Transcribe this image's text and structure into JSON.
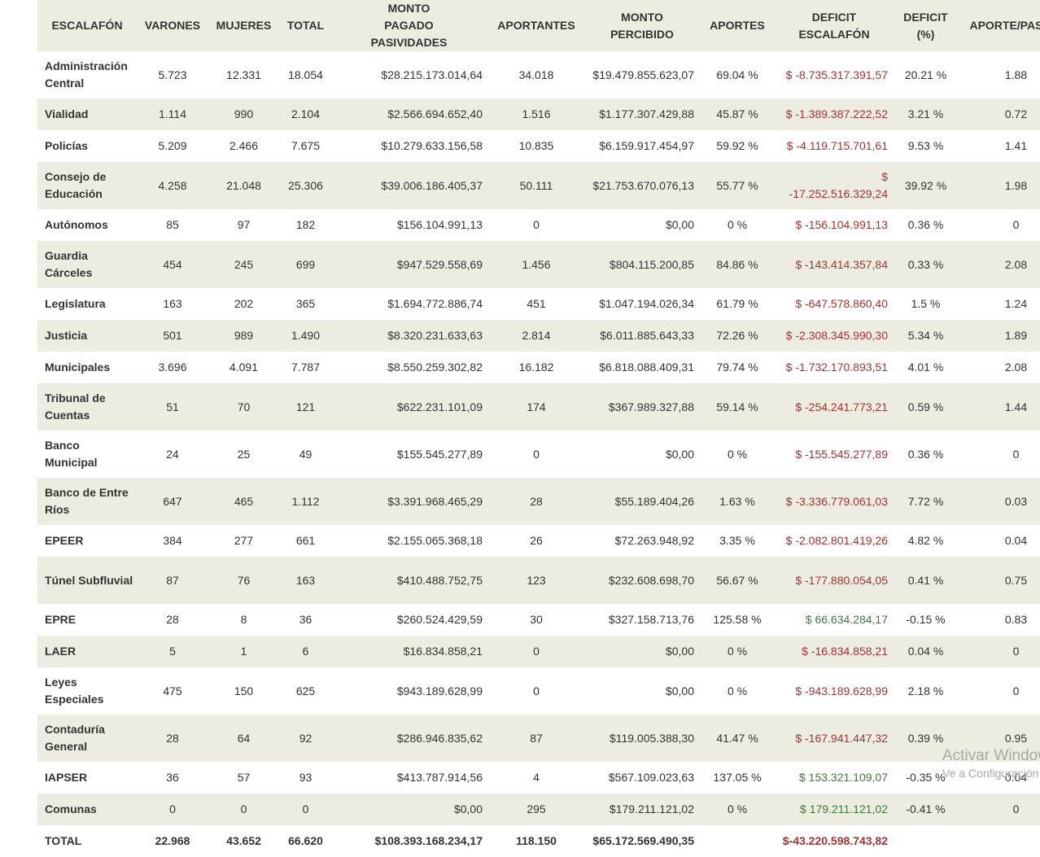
{
  "headers": [
    "ESCALAFÓN",
    "VARONES",
    "MUJERES",
    "TOTAL",
    "MONTO PAGADO PASIVIDADES",
    "APORTANTES",
    "MONTO PERCIBIDO",
    "APORTES",
    "DEFICIT ESCALAFÓN",
    "DEFICIT (%)",
    "APORTE/PASIVO"
  ],
  "rows": [
    {
      "name": "Administración Central",
      "varones": "5.723",
      "mujeres": "12.331",
      "total": "18.054",
      "monto_pagado": "$28.215.173.014,64",
      "aportantes": "34.018",
      "monto_percibido": "$19.479.855.623,07",
      "aportes": "69.04 %",
      "deficit": "$ -8.735.317.391,57",
      "deficit_sign": "neg",
      "deficit_pct": "20.21 %",
      "aporte_pasivo": "1.88"
    },
    {
      "name": "Vialidad",
      "varones": "1.114",
      "mujeres": "990",
      "total": "2.104",
      "monto_pagado": "$2.566.694.652,40",
      "aportantes": "1.516",
      "monto_percibido": "$1.177.307.429,88",
      "aportes": "45.87 %",
      "deficit": "$ -1.389.387.222,52",
      "deficit_sign": "neg",
      "deficit_pct": "3.21 %",
      "aporte_pasivo": "0.72"
    },
    {
      "name": "Policías",
      "varones": "5.209",
      "mujeres": "2.466",
      "total": "7.675",
      "monto_pagado": "$10.279.633.156,58",
      "aportantes": "10.835",
      "monto_percibido": "$6.159.917.454,97",
      "aportes": "59.92 %",
      "deficit": "$ -4.119.715.701,61",
      "deficit_sign": "neg",
      "deficit_pct": "9.53 %",
      "aporte_pasivo": "1.41"
    },
    {
      "name": "Consejo de Educación",
      "varones": "4.258",
      "mujeres": "21.048",
      "total": "25.306",
      "monto_pagado": "$39.006.186.405,37",
      "aportantes": "50.111",
      "monto_percibido": "$21.753.670.076,13",
      "aportes": "55.77 %",
      "deficit": "$ -17.252.516.329,24",
      "deficit_sign": "neg",
      "deficit_pct": "39.92 %",
      "aporte_pasivo": "1.98"
    },
    {
      "name": "Autónomos",
      "varones": "85",
      "mujeres": "97",
      "total": "182",
      "monto_pagado": "$156.104.991,13",
      "aportantes": "0",
      "monto_percibido": "$0,00",
      "aportes": "0 %",
      "deficit": "$ -156.104.991,13",
      "deficit_sign": "neg",
      "deficit_pct": "0.36 %",
      "aporte_pasivo": "0"
    },
    {
      "name": "Guardia Cárceles",
      "varones": "454",
      "mujeres": "245",
      "total": "699",
      "monto_pagado": "$947.529.558,69",
      "aportantes": "1.456",
      "monto_percibido": "$804.115.200,85",
      "aportes": "84.86 %",
      "deficit": "$ -143.414.357,84",
      "deficit_sign": "neg",
      "deficit_pct": "0.33 %",
      "aporte_pasivo": "2.08"
    },
    {
      "name": "Legislatura",
      "varones": "163",
      "mujeres": "202",
      "total": "365",
      "monto_pagado": "$1.694.772.886,74",
      "aportantes": "451",
      "monto_percibido": "$1.047.194.026,34",
      "aportes": "61.79 %",
      "deficit": "$ -647.578.860,40",
      "deficit_sign": "neg",
      "deficit_pct": "1.5 %",
      "aporte_pasivo": "1.24"
    },
    {
      "name": "Justicia",
      "varones": "501",
      "mujeres": "989",
      "total": "1.490",
      "monto_pagado": "$8.320.231.633,63",
      "aportantes": "2.814",
      "monto_percibido": "$6.011.885.643,33",
      "aportes": "72.26 %",
      "deficit": "$ -2.308.345.990,30",
      "deficit_sign": "neg",
      "deficit_pct": "5.34 %",
      "aporte_pasivo": "1.89"
    },
    {
      "name": "Municipales",
      "varones": "3.696",
      "mujeres": "4.091",
      "total": "7.787",
      "monto_pagado": "$8.550.259.302,82",
      "aportantes": "16.182",
      "monto_percibido": "$6.818.088.409,31",
      "aportes": "79.74 %",
      "deficit": "$ -1.732.170.893,51",
      "deficit_sign": "neg",
      "deficit_pct": "4.01 %",
      "aporte_pasivo": "2.08"
    },
    {
      "name": "Tribunal de Cuentas",
      "varones": "51",
      "mujeres": "70",
      "total": "121",
      "monto_pagado": "$622.231.101,09",
      "aportantes": "174",
      "monto_percibido": "$367.989.327,88",
      "aportes": "59.14 %",
      "deficit": "$ -254.241.773,21",
      "deficit_sign": "neg",
      "deficit_pct": "0.59 %",
      "aporte_pasivo": "1.44"
    },
    {
      "name": "Banco Municipal",
      "varones": "24",
      "mujeres": "25",
      "total": "49",
      "monto_pagado": "$155.545.277,89",
      "aportantes": "0",
      "monto_percibido": "$0,00",
      "aportes": "0 %",
      "deficit": "$ -155.545.277,89",
      "deficit_sign": "neg",
      "deficit_pct": "0.36 %",
      "aporte_pasivo": "0"
    },
    {
      "name": "Banco de Entre Ríos",
      "varones": "647",
      "mujeres": "465",
      "total": "1.112",
      "monto_pagado": "$3.391.968.465,29",
      "aportantes": "28",
      "monto_percibido": "$55.189.404,26",
      "aportes": "1.63 %",
      "deficit": "$ -3.336.779.061,03",
      "deficit_sign": "neg",
      "deficit_pct": "7.72 %",
      "aporte_pasivo": "0.03"
    },
    {
      "name": "EPEER",
      "varones": "384",
      "mujeres": "277",
      "total": "661",
      "monto_pagado": "$2.155.065.368,18",
      "aportantes": "26",
      "monto_percibido": "$72.263.948,92",
      "aportes": "3.35 %",
      "deficit": "$ -2.082.801.419,26",
      "deficit_sign": "neg",
      "deficit_pct": "4.82 %",
      "aporte_pasivo": "0.04"
    },
    {
      "name": "Túnel Subfluvial",
      "varones": "87",
      "mujeres": "76",
      "total": "163",
      "monto_pagado": "$410.488.752,75",
      "aportantes": "123",
      "monto_percibido": "$232.608.698,70",
      "aportes": "56.67 %",
      "deficit": "$ -177.880.054,05",
      "deficit_sign": "neg",
      "deficit_pct": "0.41 %",
      "aporte_pasivo": "0.75"
    },
    {
      "name": "EPRE",
      "varones": "28",
      "mujeres": "8",
      "total": "36",
      "monto_pagado": "$260.524.429,59",
      "aportantes": "30",
      "monto_percibido": "$327.158.713,76",
      "aportes": "125.58 %",
      "deficit": "$ 66.634.284,17",
      "deficit_sign": "pos",
      "deficit_pct": "-0.15 %",
      "aporte_pasivo": "0.83"
    },
    {
      "name": "LAER",
      "varones": "5",
      "mujeres": "1",
      "total": "6",
      "monto_pagado": "$16.834.858,21",
      "aportantes": "0",
      "monto_percibido": "$0,00",
      "aportes": "0 %",
      "deficit": "$ -16.834.858,21",
      "deficit_sign": "neg",
      "deficit_pct": "0.04 %",
      "aporte_pasivo": "0"
    },
    {
      "name": "Leyes Especiales",
      "varones": "475",
      "mujeres": "150",
      "total": "625",
      "monto_pagado": "$943.189.628,99",
      "aportantes": "0",
      "monto_percibido": "$0,00",
      "aportes": "0 %",
      "deficit": "$ -943.189.628,99",
      "deficit_sign": "neg",
      "deficit_pct": "2.18 %",
      "aporte_pasivo": "0"
    },
    {
      "name": "Contaduría General",
      "varones": "28",
      "mujeres": "64",
      "total": "92",
      "monto_pagado": "$286.946.835,62",
      "aportantes": "87",
      "monto_percibido": "$119.005.388,30",
      "aportes": "41.47 %",
      "deficit": "$ -167.941.447,32",
      "deficit_sign": "neg",
      "deficit_pct": "0.39 %",
      "aporte_pasivo": "0.95"
    },
    {
      "name": "IAPSER",
      "varones": "36",
      "mujeres": "57",
      "total": "93",
      "monto_pagado": "$413.787.914,56",
      "aportantes": "4",
      "monto_percibido": "$567.109.023,63",
      "aportes": "137.05 %",
      "deficit": "$ 153.321.109,07",
      "deficit_sign": "pos",
      "deficit_pct": "-0.35 %",
      "aporte_pasivo": "0.04"
    },
    {
      "name": "Comunas",
      "varones": "0",
      "mujeres": "0",
      "total": "0",
      "monto_pagado": "$0,00",
      "aportantes": "295",
      "monto_percibido": "$179.211.121,02",
      "aportes": "0 %",
      "deficit": "$ 179.211.121,02",
      "deficit_sign": "pos",
      "deficit_pct": "-0.41 %",
      "aporte_pasivo": "0"
    }
  ],
  "total_row": {
    "name": "TOTAL",
    "varones": "22.968",
    "mujeres": "43.652",
    "total": "66.620",
    "monto_pagado": "$108.393.168.234,17",
    "aportantes": "118.150",
    "monto_percibido": "$65.172.569.490,35",
    "aportes": "",
    "deficit": "$-43.220.598.743,82",
    "deficit_pct": "",
    "aporte_pasivo": ""
  },
  "watermark": {
    "line1": "Activar Windows",
    "line2": "Ve a Configuración para activar Windows."
  },
  "colors": {
    "header_bg": "#ecece0",
    "stripe_bg": "#ecece0",
    "negative": "#a83232",
    "positive": "#3b7a3b"
  }
}
